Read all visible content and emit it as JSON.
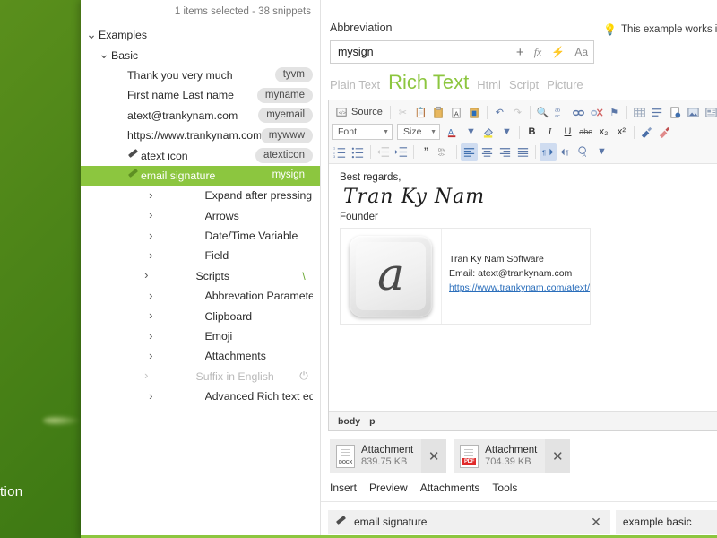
{
  "desktop": {
    "partial_text": "tion"
  },
  "sidebar": {
    "status": "1 items selected - 38 snippets",
    "tree": [
      {
        "label": "Examples",
        "chevron": "down",
        "indent": 1,
        "abbr": "",
        "mark": "",
        "state": "normal",
        "icon": ""
      },
      {
        "label": "Basic",
        "chevron": "down",
        "indent": 2,
        "abbr": "",
        "mark": "",
        "state": "normal",
        "icon": ""
      },
      {
        "label": "Thank you very much",
        "chevron": "blank",
        "indent": 3,
        "abbr": "tyvm",
        "mark": "",
        "state": "normal",
        "icon": ""
      },
      {
        "label": "First name Last name",
        "chevron": "blank",
        "indent": 3,
        "abbr": "myname",
        "mark": "",
        "state": "normal",
        "icon": ""
      },
      {
        "label": "atext@trankynam.com",
        "chevron": "blank",
        "indent": 3,
        "abbr": "myemail",
        "mark": "",
        "state": "normal",
        "icon": ""
      },
      {
        "label": "https://www.trankynam.com/ate",
        "chevron": "blank",
        "indent": 3,
        "abbr": "mywww",
        "mark": "",
        "state": "normal",
        "icon": ""
      },
      {
        "label": "atext icon",
        "chevron": "blank",
        "indent": 3,
        "abbr": "atexticon",
        "mark": "",
        "state": "normal",
        "icon": "pen-icon"
      },
      {
        "label": "email signature",
        "chevron": "blank",
        "indent": 3,
        "abbr": "mysign",
        "mark": "",
        "state": "selected",
        "icon": "pen-icon"
      },
      {
        "label": "Expand after pressing Space or Enter",
        "chevron": "right",
        "indent": 2,
        "abbr": "",
        "mark": "",
        "state": "normal",
        "icon": ""
      },
      {
        "label": "Arrows",
        "chevron": "right",
        "indent": 2,
        "abbr": "",
        "mark": "",
        "state": "normal",
        "icon": ""
      },
      {
        "label": "Date/Time Variable",
        "chevron": "right",
        "indent": 2,
        "abbr": "",
        "mark": "",
        "state": "normal",
        "icon": ""
      },
      {
        "label": "Field",
        "chevron": "right",
        "indent": 2,
        "abbr": "",
        "mark": "",
        "state": "normal",
        "icon": ""
      },
      {
        "label": "Scripts",
        "chevron": "right",
        "indent": 2,
        "abbr": "",
        "mark": "\\",
        "state": "normal",
        "icon": ""
      },
      {
        "label": "Abbrevation Parameters",
        "chevron": "right",
        "indent": 2,
        "abbr": "",
        "mark": "",
        "state": "normal",
        "icon": ""
      },
      {
        "label": "Clipboard",
        "chevron": "right",
        "indent": 2,
        "abbr": "",
        "mark": "",
        "state": "normal",
        "icon": ""
      },
      {
        "label": "Emoji",
        "chevron": "right",
        "indent": 2,
        "abbr": "",
        "mark": "",
        "state": "normal",
        "icon": ""
      },
      {
        "label": "Attachments",
        "chevron": "right",
        "indent": 2,
        "abbr": "",
        "mark": "",
        "state": "normal",
        "icon": ""
      },
      {
        "label": "Suffix in English",
        "chevron": "right",
        "indent": 2,
        "abbr": "",
        "mark": "power",
        "state": "dim",
        "icon": ""
      },
      {
        "label": "Advanced Rich text editing",
        "chevron": "right",
        "indent": 2,
        "abbr": "",
        "mark": "",
        "state": "normal",
        "icon": ""
      }
    ]
  },
  "abbreviation": {
    "caption": "Abbreviation",
    "value": "mysign",
    "tools": [
      "+",
      "fx",
      "⚡",
      "Aa"
    ]
  },
  "tip": {
    "icon": "lightbulb-icon",
    "text": "This example works in Gr"
  },
  "type_tabs": [
    {
      "label": "Plain Text",
      "active": false
    },
    {
      "label": "Rich Text",
      "active": true
    },
    {
      "label": "Html",
      "active": false
    },
    {
      "label": "Script",
      "active": false
    },
    {
      "label": "Picture",
      "active": false
    }
  ],
  "toolbar": {
    "source_label": "Source",
    "font_label": "Font",
    "size_label": "Size",
    "row1": [
      "source-button",
      "separator",
      "cut-icon",
      "copy-icon",
      "paste-icon",
      "paste-text-icon",
      "paste-word-icon",
      "separator",
      "undo-icon",
      "redo-icon",
      "separator",
      "find-icon",
      "replace-icon",
      "link-icon",
      "unlink-icon",
      "anchor-icon",
      "separator",
      "table-icon",
      "horizontal-rule-icon",
      "page-break-icon",
      "image-icon",
      "form-icon",
      "checkbox-icon",
      "radio-icon"
    ],
    "row2": [
      "font-select",
      "size-select",
      "text-color-icon",
      "background-color-icon",
      "bold-icon",
      "italic-icon",
      "underline-icon",
      "strikethrough-icon",
      "subscript-icon",
      "superscript-icon",
      "separator",
      "remove-format-icon",
      "copy-format-icon"
    ],
    "row3": [
      "numbered-list-icon",
      "bulleted-list-icon",
      "separator",
      "outdent-icon",
      "indent-icon",
      "separator",
      "blockquote-icon",
      "div-icon",
      "separator",
      "align-left-icon",
      "align-center-icon",
      "align-right-icon",
      "justify-icon",
      "separator",
      "ltr-icon",
      "rtl-icon",
      "language-icon"
    ]
  },
  "signature": {
    "greeting": "Best regards,",
    "name": "Tran Ky Nam",
    "role": "Founder",
    "keycap_glyph": "a",
    "company": "Tran Ky Nam Software",
    "email": "Email: atext@trankynam.com",
    "website": "https://www.trankynam.com/atext/"
  },
  "status": {
    "path": [
      "body",
      "p"
    ]
  },
  "attachments": [
    {
      "name": "Attachment",
      "size": "839.75 KB",
      "type": "DOCX"
    },
    {
      "name": "Attachment",
      "size": "704.39 KB",
      "type": "PDF"
    }
  ],
  "menubar": [
    "Insert",
    "Preview",
    "Attachments",
    "Tools"
  ],
  "footer": {
    "snippet_name": "email signature",
    "tag": "example basic"
  },
  "colors": {
    "accent": "#8cc63f",
    "selection": "#8cc63f",
    "link": "#2a6ebb",
    "toolbar_icon": "#5b77a8",
    "desktop_green": "#3f7a14"
  }
}
